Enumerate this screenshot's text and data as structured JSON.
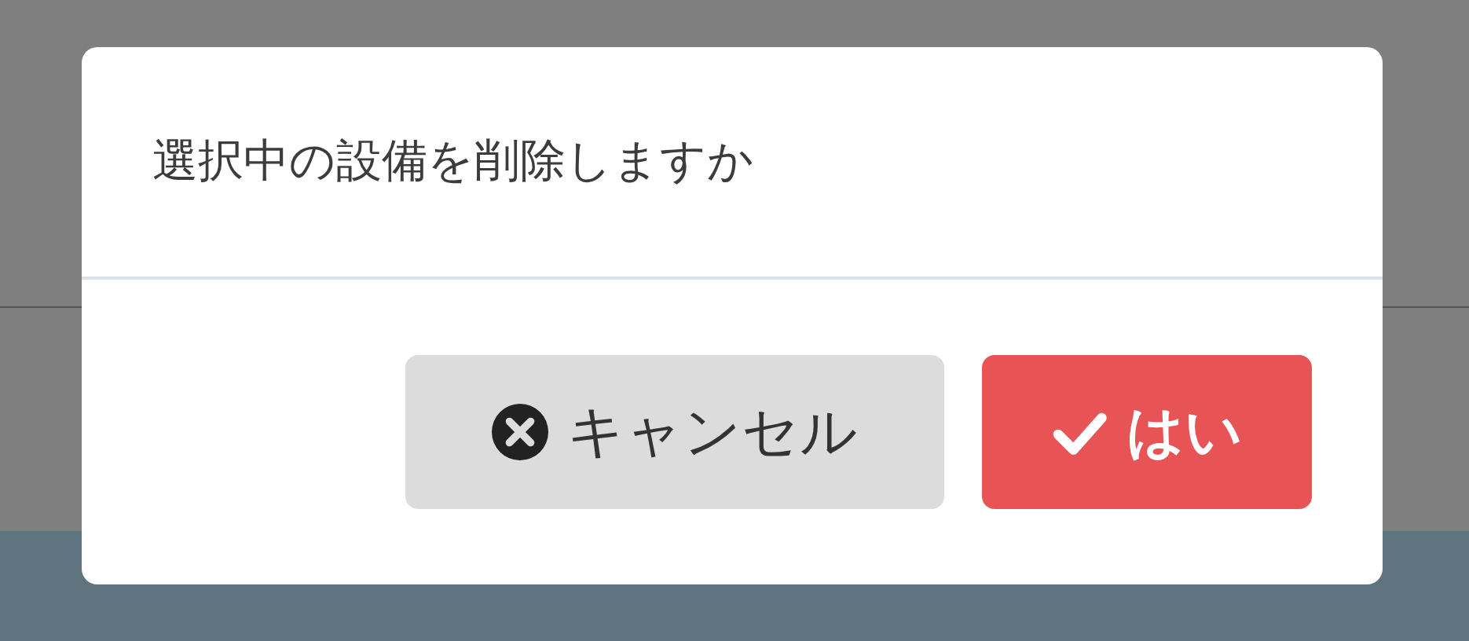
{
  "dialog": {
    "message": "選択中の設備を削除しますか",
    "buttons": [
      {
        "kind": "cancel",
        "label": "キャンセル"
      },
      {
        "kind": "confirm",
        "label": "はい"
      }
    ]
  }
}
